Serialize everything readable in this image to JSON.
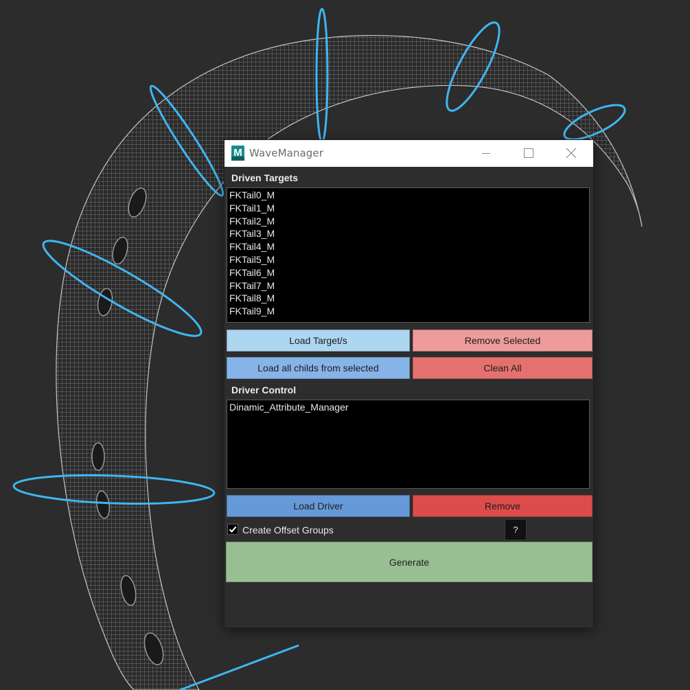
{
  "window": {
    "title": "WaveManager",
    "app_icon_letter": "M"
  },
  "driven_targets": {
    "label": "Driven Targets",
    "items": [
      "FKTail0_M",
      "FKTail1_M",
      "FKTail2_M",
      "FKTail3_M",
      "FKTail4_M",
      "FKTail5_M",
      "FKTail6_M",
      "FKTail7_M",
      "FKTail8_M",
      "FKTail9_M"
    ],
    "buttons": {
      "load_targets": "Load Target/s",
      "remove_selected": "Remove Selected",
      "load_childs": "Load all childs from selected",
      "clean_all": "Clean All"
    }
  },
  "driver_control": {
    "label": "Driver Control",
    "items": [
      "Dinamic_Attribute_Manager"
    ],
    "buttons": {
      "load_driver": "Load Driver",
      "remove": "Remove"
    }
  },
  "options": {
    "create_offset_groups_label": "Create Offset Groups",
    "create_offset_groups_checked": true,
    "help_label": "?"
  },
  "generate_label": "Generate",
  "colors": {
    "load_targets": "#add6f0",
    "remove_selected": "#ee9b99",
    "load_childs": "#87b4e8",
    "clean_all": "#e5716f",
    "load_driver": "#6699d8",
    "remove": "#dc4c4b",
    "generate": "#97bf92",
    "viewport_bg": "#2c2c2c",
    "control_curve": "#3fb6f2"
  }
}
